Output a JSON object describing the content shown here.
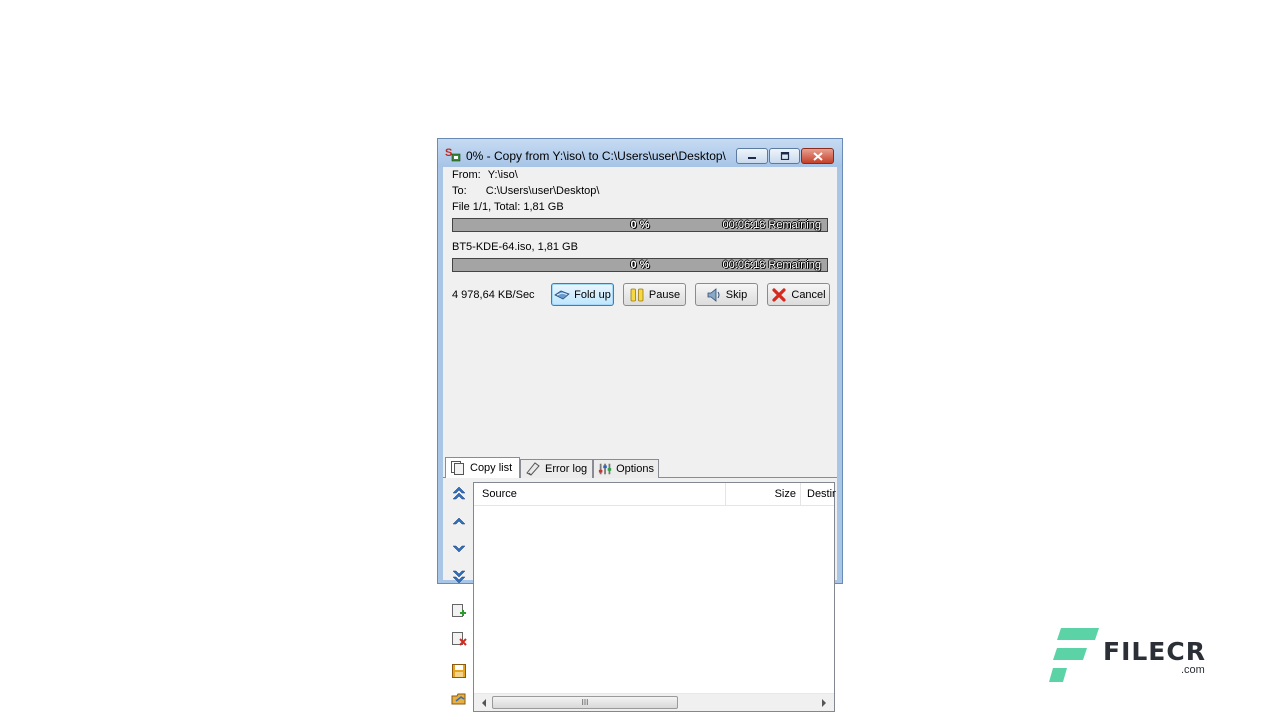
{
  "window": {
    "title": "0% - Copy from Y:\\iso\\ to C:\\Users\\user\\Desktop\\"
  },
  "transfer": {
    "from_label": "From:",
    "from_value": "Y:\\iso\\",
    "to_label": "To:",
    "to_value": "C:\\Users\\user\\Desktop\\",
    "total_line": "File 1/1, Total: 1,81 GB",
    "total_progress": {
      "percent_text": "0 %",
      "remaining": "00:06:18 Remaining",
      "fraction": 0
    },
    "file_line": "BT5-KDE-64.iso, 1,81 GB",
    "file_progress": {
      "percent_text": "0 %",
      "remaining": "00:06:18 Remaining",
      "fraction": 0
    },
    "speed": "4 978,64 KB/Sec"
  },
  "buttons": {
    "fold_up": "Fold up",
    "pause": "Pause",
    "skip": "Skip",
    "cancel": "Cancel"
  },
  "tabs": [
    "Copy list",
    "Error log",
    "Options"
  ],
  "list": {
    "columns": [
      "Source",
      "Size",
      "Destin"
    ],
    "scroll_grip": "III"
  },
  "icons": [
    "app-icon",
    "fold-up-icon",
    "pause-icon",
    "skip-icon",
    "cancel-icon",
    "copy-list-icon",
    "error-log-icon",
    "options-icon",
    "move-top-icon",
    "move-up-icon",
    "move-down-icon",
    "move-bottom-icon",
    "add-file-icon",
    "remove-file-icon",
    "save-list-icon",
    "load-list-icon"
  ],
  "watermark": {
    "brand": "FILECR",
    "suffix": ".com",
    "colors": {
      "mark": "#5bd3a6",
      "text": "#2b2f36"
    }
  }
}
